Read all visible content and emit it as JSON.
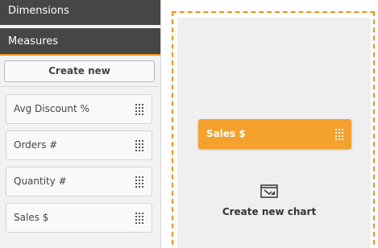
{
  "sidebar": {
    "dimensions_label": "Dimensions",
    "measures_label": "Measures",
    "create_new_label": "Create new",
    "items": [
      {
        "label": "Avg Discount %"
      },
      {
        "label": "Orders #"
      },
      {
        "label": "Quantity #"
      },
      {
        "label": "Sales $"
      }
    ]
  },
  "canvas": {
    "dragged_item_label": "Sales $",
    "create_chart_label": "Create new chart"
  },
  "colors": {
    "accent": "#f0911c",
    "chip": "#f4a12e",
    "header_bg": "#464646"
  }
}
